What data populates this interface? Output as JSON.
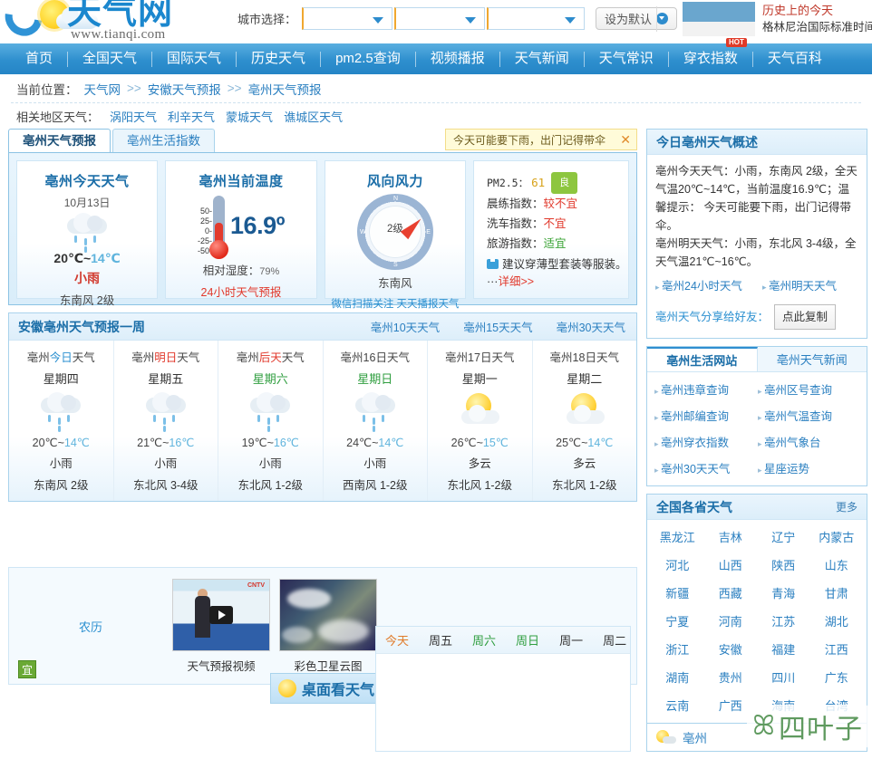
{
  "site": {
    "name_cn": "天气网",
    "url": "www.tianqi.com"
  },
  "header": {
    "city_select_label": "城市选择：",
    "selects": [
      {
        "value": ""
      },
      {
        "value": ""
      },
      {
        "value": ""
      }
    ],
    "set_default_button": "设为默认",
    "history_today": "历史上的今天",
    "gmt_label": "格林尼治国际标准时间"
  },
  "nav": {
    "items": [
      {
        "label": "首页",
        "hot": false
      },
      {
        "label": "全国天气",
        "hot": false
      },
      {
        "label": "国际天气",
        "hot": false
      },
      {
        "label": "历史天气",
        "hot": false
      },
      {
        "label": "pm2.5查询",
        "hot": false
      },
      {
        "label": "视频播报",
        "hot": false
      },
      {
        "label": "天气新闻",
        "hot": false
      },
      {
        "label": "天气常识",
        "hot": false
      },
      {
        "label": "穿衣指数",
        "hot": true,
        "hot_label": "HOT"
      },
      {
        "label": "天气百科",
        "hot": false
      }
    ]
  },
  "breadcrumb": {
    "prefix": "当前位置：",
    "items": [
      "天气网",
      "安徽天气预报",
      "亳州天气预报"
    ],
    "separator": ">>"
  },
  "related": {
    "label": "相关地区天气：",
    "items": [
      "涡阳天气",
      "利辛天气",
      "蒙城天气",
      "谯城区天气"
    ]
  },
  "tabs": {
    "active": "亳州天气预报",
    "idle": "亳州生活指数"
  },
  "alert": {
    "text": "今天可能要下雨，出门记得带伞",
    "close": "✕"
  },
  "today_card": {
    "title": "亳州今天天气",
    "date": "10月13日",
    "icon": "light-rain-icon",
    "high": "20℃",
    "tilde": "~",
    "low": "14℃",
    "condition": "小雨",
    "wind": "东南风  2级"
  },
  "current_temp": {
    "title": "亳州当前温度",
    "scale": [
      "50-",
      "25-",
      "0-",
      "-25-",
      "-50-"
    ],
    "value": "16.9º",
    "humidity_label": "相对湿度：",
    "humidity_value": "79%",
    "link_24h": "24小时天气预报"
  },
  "wind_card": {
    "title": "风向风力",
    "compass_n": "N",
    "compass_s": "S",
    "compass_w": "W",
    "compass_e": "E",
    "level": "2级",
    "direction": "东南风",
    "wechat_text": "微信扫描关注  天天播报天气"
  },
  "indices": {
    "pm_label": "PM2.5：",
    "pm_value": "61",
    "pm_grade": "良",
    "rows": [
      {
        "label": "晨练指数：",
        "value": "较不宜",
        "tone": "bad"
      },
      {
        "label": "洗车指数：",
        "value": "不宜",
        "tone": "bad"
      },
      {
        "label": "旅游指数：",
        "value": "适宜",
        "tone": "good"
      }
    ],
    "dress_icon": "shirt-icon",
    "dress_note": "建议穿薄型套装等服装。···",
    "dress_detail": "详细>>"
  },
  "week": {
    "title": "安徽亳州天气预报一周",
    "links": [
      "亳州10天天气",
      "亳州15天天气",
      "亳州30天天气"
    ],
    "days": [
      {
        "title_pre": "亳州",
        "title_hl": "今日",
        "title_hl_class": "hl",
        "title_post": "天气",
        "dow": "星期四",
        "weekend": false,
        "icon": "light-rain-icon",
        "high": "20℃",
        "low": "14℃",
        "cond": "小雨",
        "wind": "东南风  2级"
      },
      {
        "title_pre": "亳州",
        "title_hl": "明日",
        "title_hl_class": "hlr",
        "title_post": "天气",
        "dow": "星期五",
        "weekend": false,
        "icon": "light-rain-icon",
        "high": "21℃",
        "low": "16℃",
        "cond": "小雨",
        "wind": "东北风  3-4级"
      },
      {
        "title_pre": "亳州",
        "title_hl": "后天",
        "title_hl_class": "hlr",
        "title_post": "天气",
        "dow": "星期六",
        "weekend": true,
        "icon": "light-rain-icon",
        "high": "19℃",
        "low": "16℃",
        "cond": "小雨",
        "wind": "东北风  1-2级"
      },
      {
        "title_pre": "亳州16日天气",
        "title_hl": "",
        "title_hl_class": "",
        "title_post": "",
        "dow": "星期日",
        "weekend": true,
        "icon": "light-rain-icon",
        "high": "24℃",
        "low": "14℃",
        "cond": "小雨",
        "wind": "西南风  1-2级"
      },
      {
        "title_pre": "亳州17日天气",
        "title_hl": "",
        "title_hl_class": "",
        "title_post": "",
        "dow": "星期一",
        "weekend": false,
        "icon": "sunny-cloud-icon",
        "high": "26℃",
        "low": "15℃",
        "cond": "多云",
        "wind": "东北风  1-2级"
      },
      {
        "title_pre": "亳州18日天气",
        "title_hl": "",
        "title_hl_class": "",
        "title_post": "",
        "dow": "星期二",
        "weekend": false,
        "icon": "sunny-cloud-icon",
        "high": "25℃",
        "low": "14℃",
        "cond": "多云",
        "wind": "东北风  1-2级"
      }
    ]
  },
  "media": {
    "lunar_label": "农历",
    "video_caption": "天气预报视频",
    "sat_caption": "彩色卫星云图",
    "yi_badge": "宜",
    "banner_text": "桌面看天气",
    "cctv_mark": "CNTV"
  },
  "hourly": {
    "tabs": [
      {
        "label": "今天",
        "state": "today"
      },
      {
        "label": "周五",
        "state": "normal"
      },
      {
        "label": "周六",
        "state": "weekend"
      },
      {
        "label": "周日",
        "state": "weekend"
      },
      {
        "label": "周一",
        "state": "normal"
      },
      {
        "label": "周二",
        "state": "normal"
      }
    ]
  },
  "summary": {
    "title": "今日亳州天气概述",
    "line1": "亳州今天天气：小雨，东南风  2级，全天气温20℃~14℃，当前温度16.9℃；温馨提示：  今天可能要下雨，出门记得带伞。",
    "line2": "亳州明天天气：小雨，东北风  3-4级，全天气温21℃~16℃。",
    "links": [
      "亳州24小时天气",
      "亳州明天天气"
    ],
    "share_label": "亳州天气分享给好友：",
    "copy_button": "点此复制"
  },
  "life_sites": {
    "tab_active": "亳州生活网站",
    "tab_idle": "亳州天气新闻",
    "links": [
      "亳州违章查询",
      "亳州区号查询",
      "亳州邮编查询",
      "亳州气温查询",
      "亳州穿衣指数",
      "亳州气象台",
      "亳州30天天气",
      "星座运势"
    ]
  },
  "provinces": {
    "title": "全国各省天气",
    "more": "更多",
    "items": [
      "黑龙江",
      "吉林",
      "辽宁",
      "内蒙古",
      "河北",
      "山西",
      "陕西",
      "山东",
      "新疆",
      "西藏",
      "青海",
      "甘肃",
      "宁夏",
      "河南",
      "江苏",
      "湖北",
      "浙江",
      "安徽",
      "福建",
      "江西",
      "湖南",
      "贵州",
      "四川",
      "广东",
      "云南",
      "广西",
      "海南",
      "台湾"
    ],
    "footer_item": "亳州"
  },
  "watermark": {
    "mark": "ꕤ",
    "text": "四叶子"
  }
}
